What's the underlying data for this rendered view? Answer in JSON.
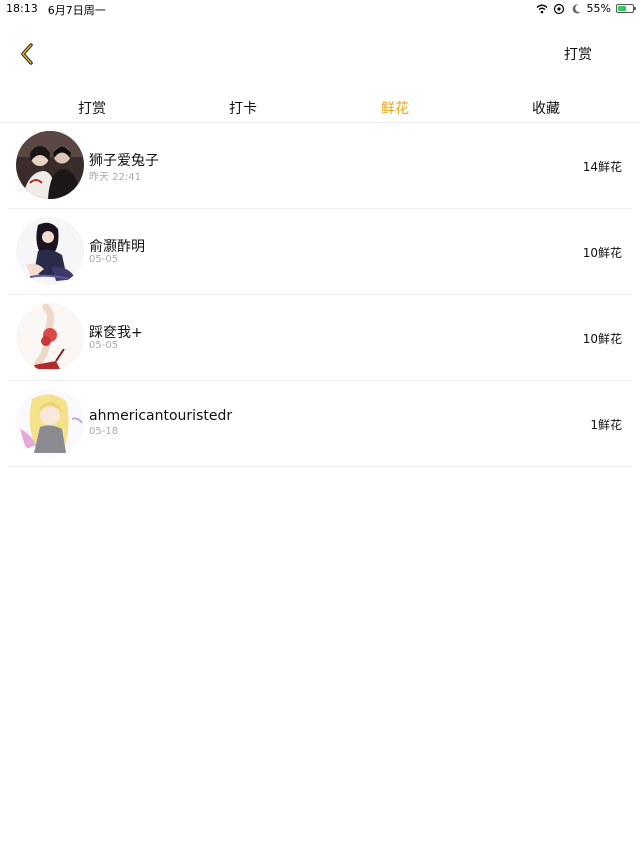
{
  "status_bar": {
    "time": "18:13",
    "date": "6月7日周一",
    "battery_percent": "55%",
    "battery_level": 0.55,
    "icons": [
      "wifi-icon",
      "location-icon",
      "moon-icon",
      "battery-charging-icon"
    ]
  },
  "nav": {
    "back_icon": "chevron-left-icon",
    "action_label": "打赏",
    "accent_color": "#f0a40c"
  },
  "tabs": [
    {
      "label": "打赏",
      "active": false
    },
    {
      "label": "打卡",
      "active": false
    },
    {
      "label": "鲜花",
      "active": true
    },
    {
      "label": "收藏",
      "active": false
    }
  ],
  "list": [
    {
      "name": "狮子爱兔子",
      "time": "昨天 22:41",
      "count": "14鲜花"
    },
    {
      "name": "俞灏酢明",
      "time": "05-05",
      "count": "10鲜花"
    },
    {
      "name": "踩奁我+",
      "time": "05-05",
      "count": "10鲜花"
    },
    {
      "name": "ahmericantouristedr",
      "time": "05-18",
      "count": "1鲜花"
    }
  ]
}
